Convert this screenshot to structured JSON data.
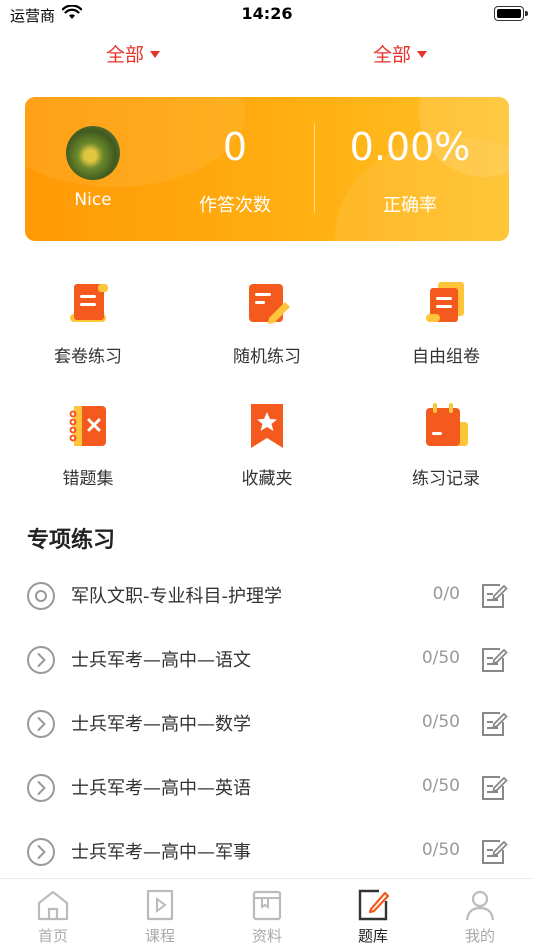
{
  "status": {
    "carrier": "运营商",
    "time": "14:26"
  },
  "filters": [
    {
      "label": "全部"
    },
    {
      "label": "全部"
    }
  ],
  "profile": {
    "nickname": "Nice"
  },
  "stats": [
    {
      "value": "0",
      "label": "作答次数"
    },
    {
      "value": "0.00%",
      "label": "正确率"
    }
  ],
  "grid": [
    {
      "label": "套卷练习",
      "icon": "scroll-doc-icon"
    },
    {
      "label": "随机练习",
      "icon": "doc-pencil-icon"
    },
    {
      "label": "自由组卷",
      "icon": "stacked-doc-icon"
    },
    {
      "label": "错题集",
      "icon": "notebook-x-icon"
    },
    {
      "label": "收藏夹",
      "icon": "bookmark-star-icon"
    },
    {
      "label": "练习记录",
      "icon": "calendar-record-icon"
    }
  ],
  "section": {
    "title": "专项练习"
  },
  "topics": [
    {
      "title": "军队文职-专业科目-护理学",
      "count": "0/0",
      "expanded": true
    },
    {
      "title": "士兵军考—高中—语文",
      "count": "0/50",
      "expanded": false
    },
    {
      "title": "士兵军考—高中—数学",
      "count": "0/50",
      "expanded": false
    },
    {
      "title": "士兵军考—高中—英语",
      "count": "0/50",
      "expanded": false
    },
    {
      "title": "士兵军考—高中—军事",
      "count": "0/50",
      "expanded": false
    }
  ],
  "tabs": [
    {
      "label": "首页",
      "icon": "home-icon"
    },
    {
      "label": "课程",
      "icon": "course-play-icon"
    },
    {
      "label": "资料",
      "icon": "materials-icon"
    },
    {
      "label": "题库",
      "icon": "question-bank-icon",
      "active": true
    },
    {
      "label": "我的",
      "icon": "profile-icon"
    }
  ],
  "colors": {
    "accent": "#e8322c",
    "card_start": "#ff9a06",
    "card_end": "#ffc22a",
    "icon_orange": "#f45a1e",
    "icon_yellow": "#ffc53a"
  }
}
